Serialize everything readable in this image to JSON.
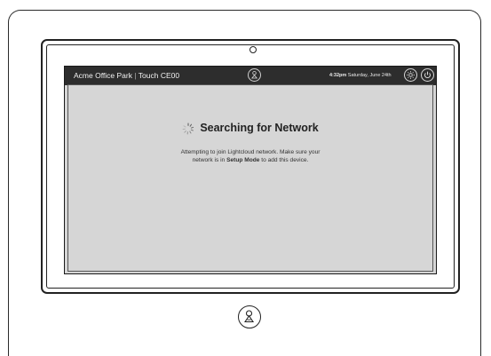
{
  "device": {
    "title_location": "Acme Office Park",
    "title_separator": "|",
    "title_device": "Touch CE00",
    "clock_time": "4:32pm",
    "clock_date": "Saturday, June 24th"
  },
  "status": {
    "heading": "Searching for Network",
    "message_line1_prefix": "Attempting to join Lightcloud network. Make sure your",
    "message_line2_prefix": "network is in ",
    "message_emphasis": "Setup Mode",
    "message_line2_suffix": " to add this device."
  },
  "icons": {
    "center_top": "person-icon",
    "brightness": "brightness-icon",
    "power": "power-icon",
    "home": "lightcloud-home-icon",
    "spinner": "spinner-icon"
  }
}
